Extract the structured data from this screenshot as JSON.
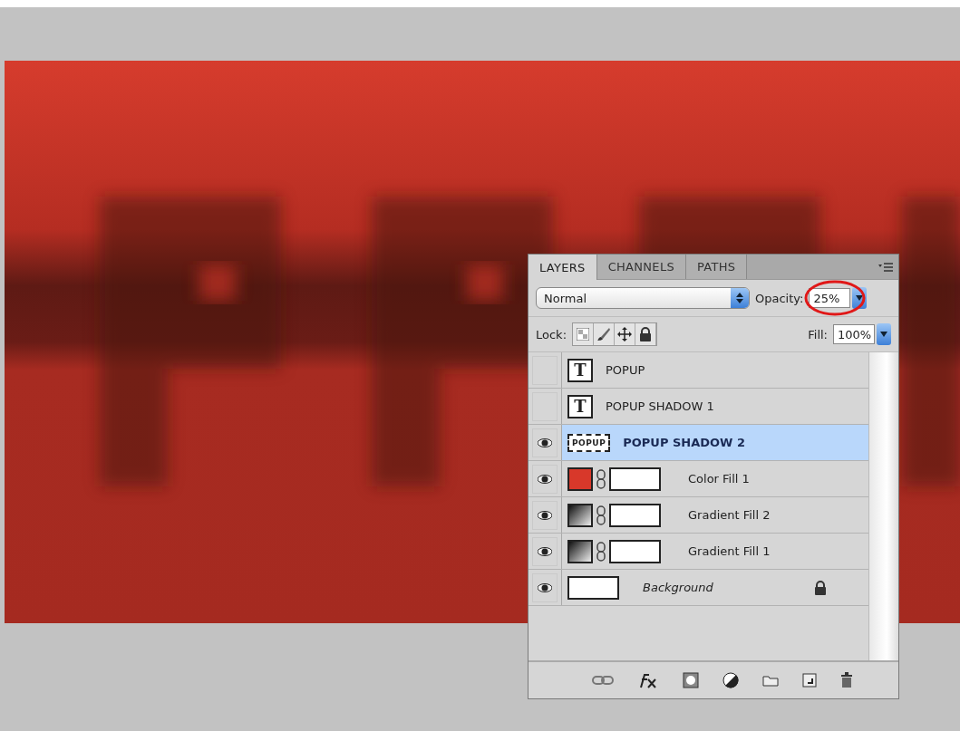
{
  "panel": {
    "tabs": [
      {
        "label": "LAYERS",
        "selected": true
      },
      {
        "label": "CHANNELS",
        "selected": false
      },
      {
        "label": "PATHS",
        "selected": false
      }
    ],
    "blend_mode": "Normal",
    "opacity": {
      "label": "Opacity:",
      "value": "25%",
      "highlighted": true
    },
    "lock": {
      "label": "Lock:"
    },
    "fill": {
      "label": "Fill:",
      "value": "100%"
    },
    "layers": [
      {
        "kind": "text",
        "type_glyph": "T",
        "name": "POPUP",
        "visible": false,
        "selected": false
      },
      {
        "kind": "text",
        "type_glyph": "T",
        "name": "POPUP SHADOW 1",
        "visible": false,
        "selected": false
      },
      {
        "kind": "smart",
        "name": "POPUP SHADOW 2",
        "thumbnail_text": "POPUP",
        "visible": true,
        "selected": true
      },
      {
        "kind": "fill",
        "name": "Color Fill 1",
        "color": "#d8382a",
        "visible": true,
        "selected": false
      },
      {
        "kind": "gradient",
        "name": "Gradient Fill 2",
        "visible": true,
        "selected": false
      },
      {
        "kind": "gradient",
        "name": "Gradient Fill 1",
        "visible": true,
        "selected": false
      },
      {
        "kind": "background",
        "name": "Background",
        "visible": true,
        "selected": false
      }
    ]
  }
}
